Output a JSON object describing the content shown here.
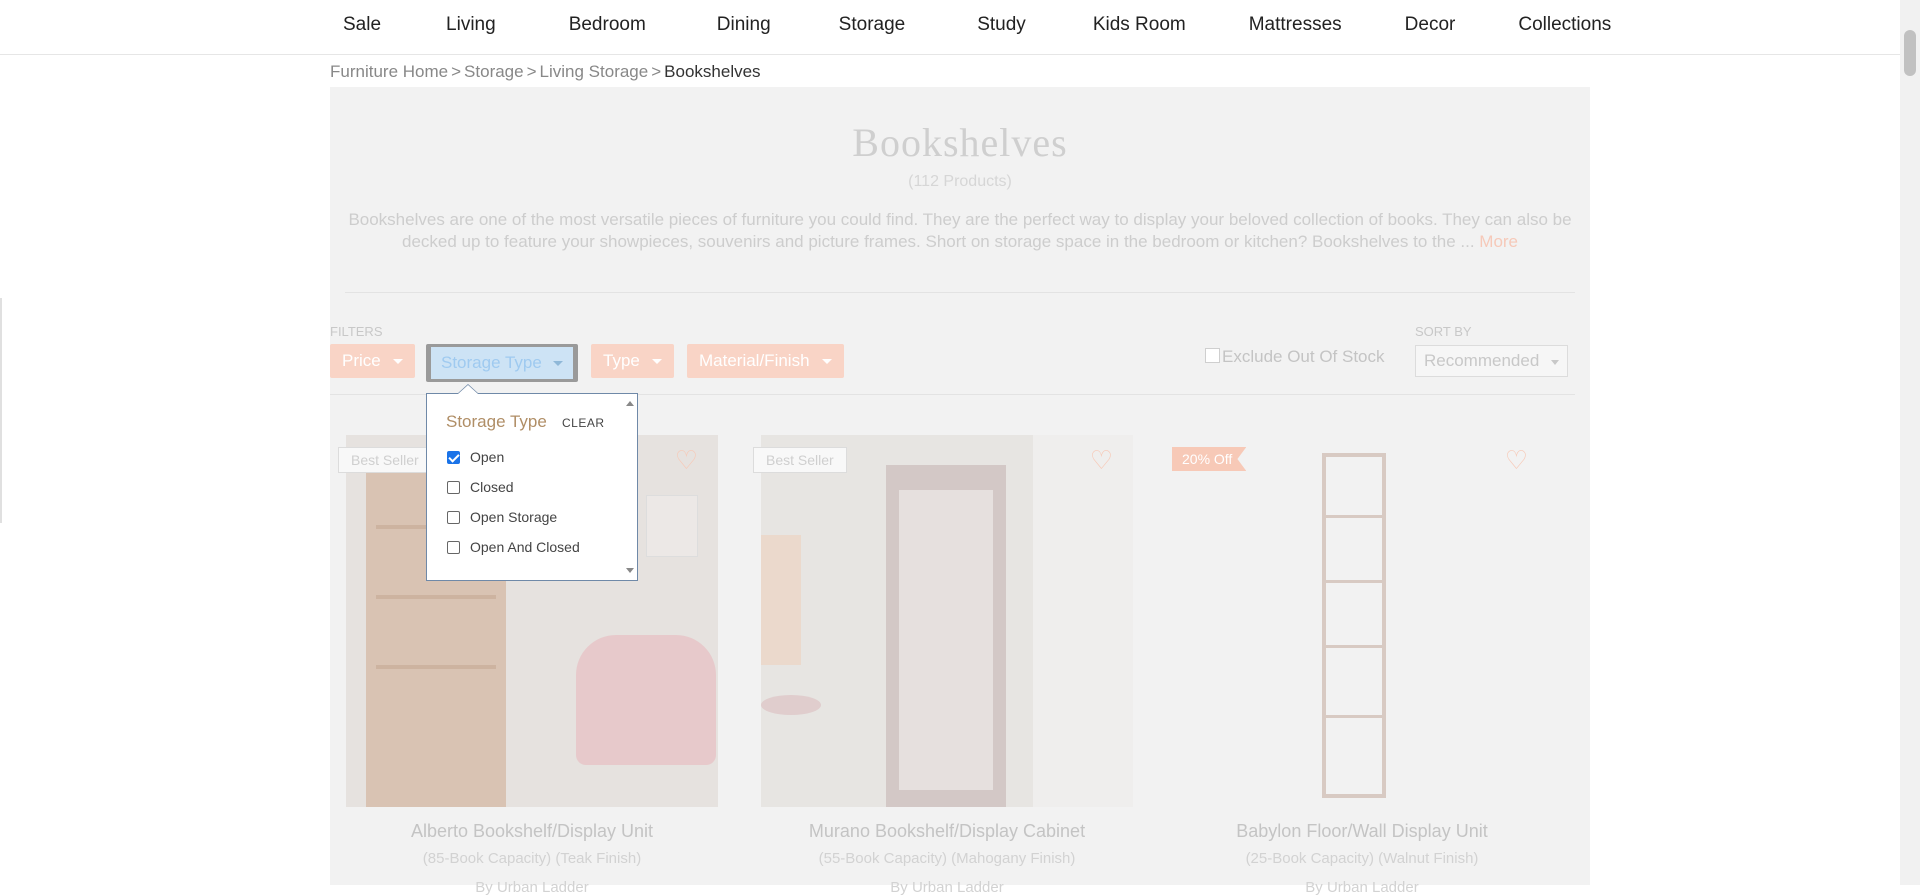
{
  "nav": {
    "items": [
      "Sale",
      "Living",
      "Bedroom",
      "Dining",
      "Storage",
      "Study",
      "Kids Room",
      "Mattresses",
      "Decor",
      "Collections"
    ]
  },
  "breadcrumb": {
    "items": [
      "Furniture Home",
      "Storage",
      "Living Storage"
    ],
    "current": "Bookshelves",
    "separator": ">"
  },
  "header": {
    "title": "Bookshelves",
    "count": "(112 Products)",
    "description": "Bookshelves are one of the most versatile pieces of furniture you could find. They are the perfect way to display your beloved collection of books. They can also be decked up to feature your showpieces, souvenirs and picture frames. Short on storage space in the bedroom or kitchen? Bookshelves to the ...",
    "more_link": "More"
  },
  "filters": {
    "label": "FILTERS",
    "buttons": [
      "Price",
      "Storage Type",
      "Type",
      "Material/Finish"
    ],
    "exclude_out_of_stock": "Exclude Out Of Stock",
    "exclude_checked": false
  },
  "sort": {
    "label": "SORT BY",
    "selected": "Recommended"
  },
  "dropdown": {
    "title": "Storage Type",
    "clear": "CLEAR",
    "options": [
      {
        "label": "Open",
        "checked": true
      },
      {
        "label": "Closed",
        "checked": false
      },
      {
        "label": "Open Storage",
        "checked": false
      },
      {
        "label": "Open And Closed",
        "checked": false
      }
    ]
  },
  "products": [
    {
      "badge": "Best Seller",
      "name": "Alberto Bookshelf/Display Unit",
      "sub": "(85-Book Capacity) (Teak Finish)",
      "by": "By Urban Ladder"
    },
    {
      "badge": "Best Seller",
      "name": "Murano Bookshelf/Display Cabinet",
      "sub": "(55-Book Capacity) (Mahogany Finish)",
      "by": "By Urban Ladder"
    },
    {
      "badge": "20% Off",
      "name": "Babylon Floor/Wall Display Unit",
      "sub": "(25-Book Capacity) (Walnut Finish)",
      "by": "By Urban Ladder"
    }
  ],
  "colors": {
    "accent": "#f9d4c6",
    "dropdown_title": "#b08e66",
    "checkbox_checked": "#1a73e8"
  },
  "icons": {
    "wishlist": "heart-outline-icon",
    "caret": "chevron-down-icon"
  }
}
